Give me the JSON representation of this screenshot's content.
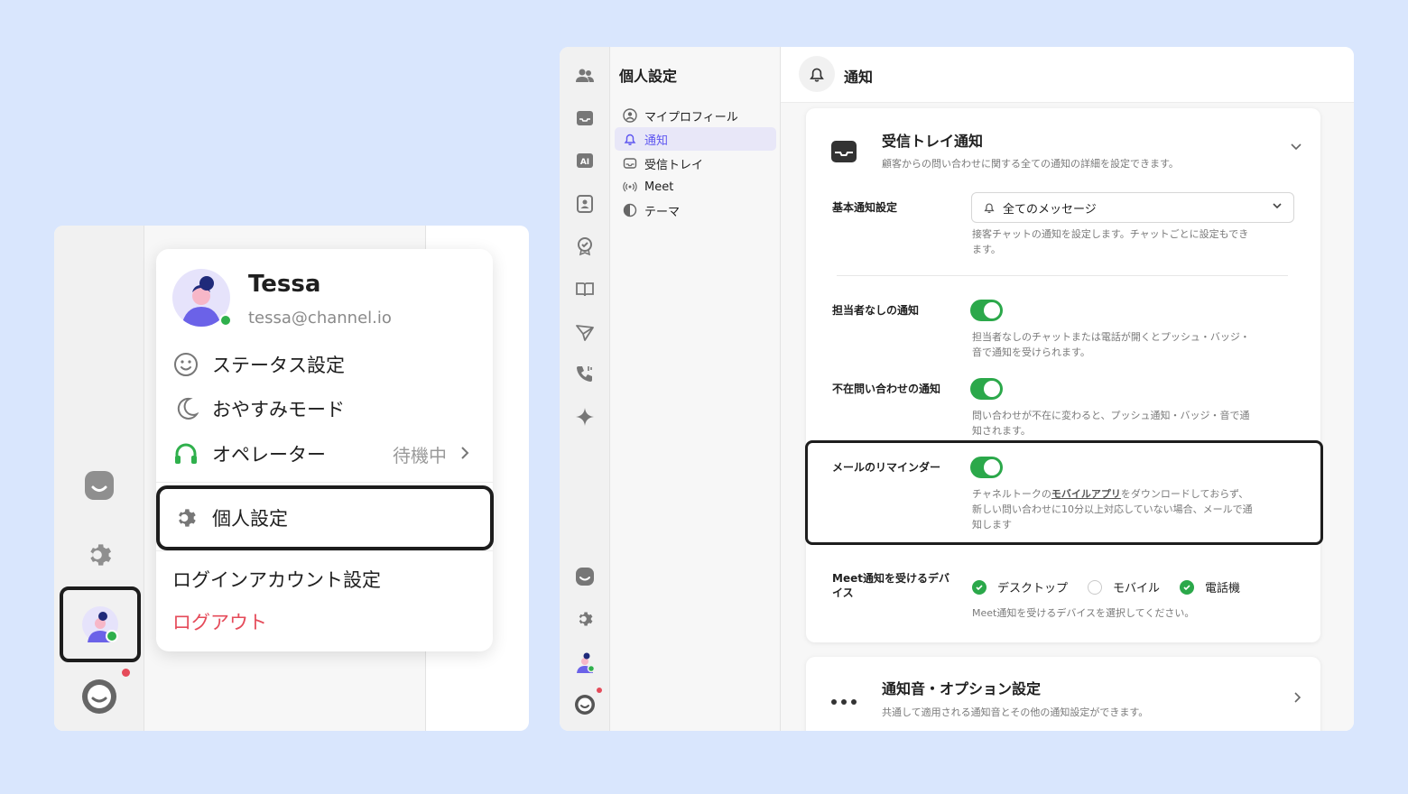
{
  "colors": {
    "accent": "#5e56f0",
    "online": "#2fb04c",
    "toggle": "#2ba84a",
    "logout": "#e54b5a",
    "background": "#d9e6fd"
  },
  "menu": {
    "name": "Tessa",
    "email": "tessa@channel.io",
    "items": [
      {
        "label": "ステータス設定",
        "icon": "smiley-icon"
      },
      {
        "label": "おやすみモード",
        "icon": "moon-icon"
      },
      {
        "label": "オペレーター",
        "icon": "headset-icon",
        "sub": "待機中"
      },
      {
        "label": "個人設定",
        "icon": "gear-icon"
      },
      {
        "label": "ログインアカウント設定"
      },
      {
        "label": "ログアウト"
      }
    ]
  },
  "settings": {
    "nav_title": "個人設定",
    "nav_items": [
      {
        "label": "マイプロフィール",
        "icon": "profile-icon"
      },
      {
        "label": "通知",
        "icon": "bell-icon",
        "active": true
      },
      {
        "label": "受信トレイ",
        "icon": "inbox-icon"
      },
      {
        "label": "Meet",
        "icon": "broadcast-icon"
      },
      {
        "label": "テーマ",
        "icon": "theme-icon"
      }
    ],
    "header_title": "通知",
    "inbox_section": {
      "title": "受信トレイ通知",
      "description": "顧客からの問い合わせに関する全ての通知の詳細を設定できます。",
      "basic_label": "基本通知設定",
      "basic_value": "全てのメッセージ",
      "basic_desc_1": "接客チャットの通知を設定します。チャットごとに設定もでき",
      "basic_desc_2": "ます。",
      "unassigned_label": "担当者なしの通知",
      "unassigned_desc_1": "担当者なしのチャットまたは電話が開くとプッシュ・バッジ・",
      "unassigned_desc_2": "音で通知を受けられます。",
      "absent_label": "不在問い合わせの通知",
      "absent_desc_1": "問い合わせが不在に変わると、プッシュ通知・バッジ・音で通",
      "absent_desc_2": "知されます。",
      "reminder_label": "メールのリマインダー",
      "reminder_desc_pre": "チャネルトークの",
      "reminder_desc_link": "モバイルアプリ",
      "reminder_desc_post": "をダウンロードしておらず、",
      "reminder_desc_2": "新しい問い合わせに10分以上対応していない場合、メールで通",
      "reminder_desc_3": "知します",
      "meet_label_1": "Meet通知を受けるデバ",
      "meet_label_2": "イス",
      "devices": [
        {
          "label": "デスクトップ",
          "checked": true
        },
        {
          "label": "モバイル",
          "checked": false
        },
        {
          "label": "電話機",
          "checked": true
        }
      ],
      "meet_desc": "Meet通知を受けるデバイスを選択してください。"
    },
    "sound_section": {
      "title": "通知音・オプション設定",
      "description": "共通して適用される通知音とその他の通知設定ができます。"
    }
  }
}
